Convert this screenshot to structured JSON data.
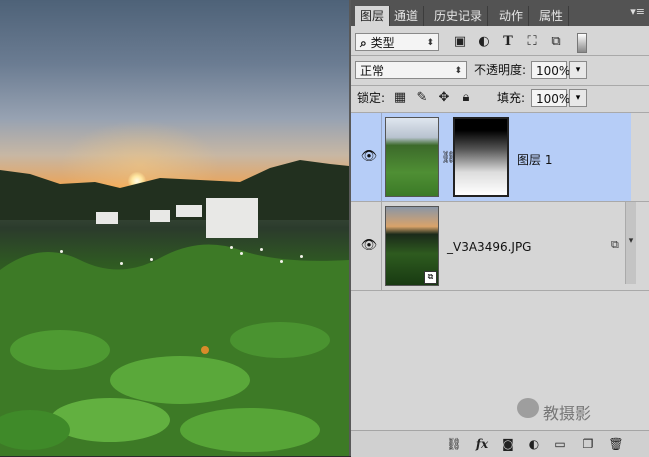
{
  "panel": {
    "tabs": [
      {
        "label": "图层",
        "active": true
      },
      {
        "label": "通道",
        "active": false
      },
      {
        "label": "历史记录",
        "active": false
      },
      {
        "label": "动作",
        "active": false
      },
      {
        "label": "属性",
        "active": false
      }
    ],
    "menu_icon": "panel-menu-icon",
    "filter": {
      "search_icon": "⌕",
      "kind_label": "类型"
    },
    "filter_icons": [
      "image-filter-icon",
      "adjustment-filter-icon",
      "type-filter-icon",
      "shape-filter-icon",
      "smart-object-filter-icon"
    ],
    "blend_mode": "正常",
    "opacity_label": "不透明度:",
    "opacity_value": "100%",
    "lock_label": "锁定:",
    "fill_label": "填充:",
    "fill_value": "100%",
    "layers": [
      {
        "name": "图层 1",
        "selected": true,
        "has_mask": true
      },
      {
        "name": "_V3A3496.JPG",
        "selected": false,
        "smart_object": true
      }
    ],
    "watermark": "教摄影"
  },
  "colors": {
    "selected_layer": "#b6cdf7",
    "panel_bg": "#d6d6d6",
    "tab_bar": "#535353"
  }
}
